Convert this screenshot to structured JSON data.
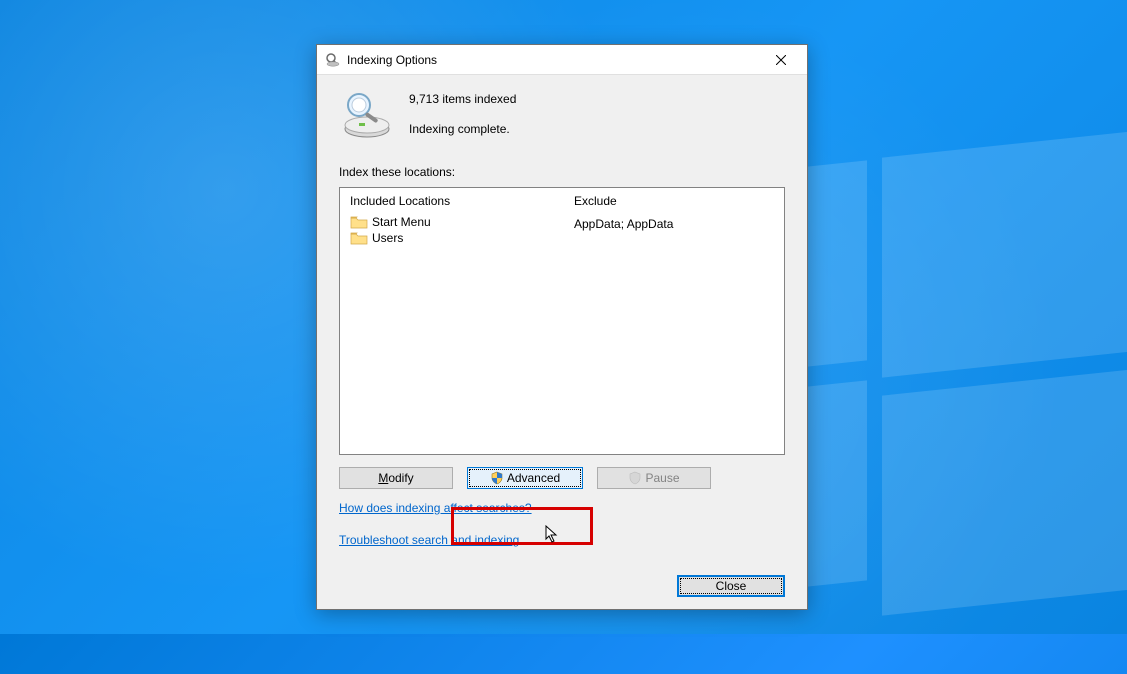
{
  "dialog": {
    "title": "Indexing Options",
    "status_count": "9,713 items indexed",
    "status_msg": "Indexing complete.",
    "section_label": "Index these locations:",
    "columns": {
      "included": "Included Locations",
      "exclude": "Exclude"
    },
    "locations": [
      {
        "name": "Start Menu",
        "exclude": ""
      },
      {
        "name": "Users",
        "exclude": "AppData; AppData"
      }
    ],
    "buttons": {
      "modify": "Modify",
      "advanced": "Advanced",
      "pause": "Pause",
      "close": "Close"
    },
    "links": {
      "how": "How does indexing affect searches?",
      "troubleshoot": "Troubleshoot search and indexing"
    }
  }
}
